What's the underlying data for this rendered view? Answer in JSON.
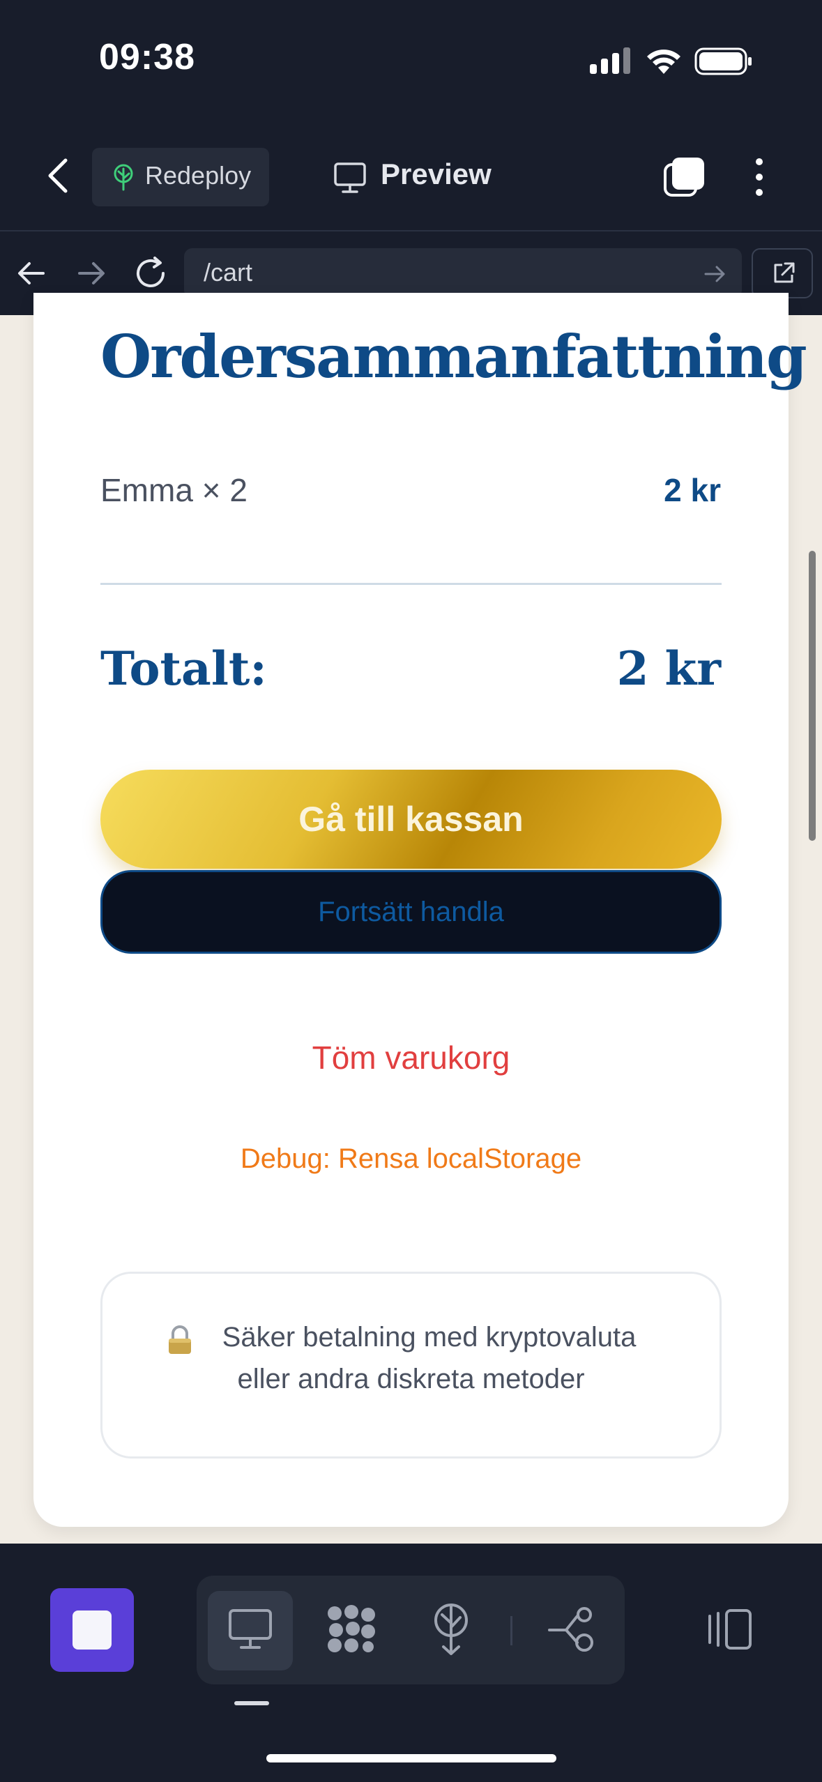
{
  "status_bar": {
    "time": "09:38"
  },
  "toolbar": {
    "redeploy_label": "Redeploy",
    "preview_label": "Preview"
  },
  "browser": {
    "url": "/cart"
  },
  "cart": {
    "title": "Ordersammanfattning",
    "items": [
      {
        "name": "Emma × 2",
        "price": "2 kr"
      }
    ],
    "total_label": "Totalt:",
    "total_value": "2 kr",
    "checkout_label": "Gå till kassan",
    "continue_label": "Fortsätt handla",
    "empty_label": "Töm varukorg",
    "debug_label": "Debug: Rensa localStorage",
    "secure_line1": "Säker betalning med kryptovaluta",
    "secure_line2": "eller andra diskreta metoder"
  },
  "colors": {
    "primary": "#0e4a86",
    "gold": "#d9a51d",
    "danger": "#e13f3f",
    "warning": "#f07a18",
    "stop_button": "#5a3fd8"
  },
  "icons": [
    "back-icon",
    "tree-icon",
    "monitor-icon",
    "tabs-icon",
    "more-icon",
    "arrow-left-icon",
    "arrow-right-icon",
    "reload-icon",
    "go-icon",
    "external-link-icon",
    "lock-icon",
    "stop-icon",
    "desktop-icon",
    "grid-icon",
    "deploy-icon",
    "flow-icon",
    "sidebar-icon"
  ]
}
